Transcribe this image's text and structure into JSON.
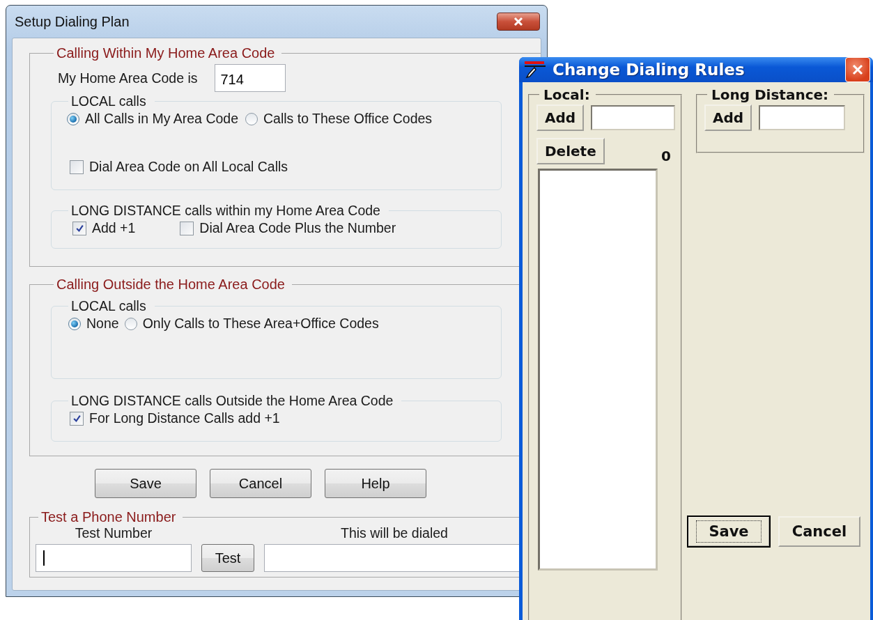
{
  "setup_window": {
    "title": "Setup Dialing Plan",
    "home_group": {
      "legend": "Calling Within My Home Area Code",
      "area_code_label": "My Home Area Code is",
      "area_code_value": "714",
      "local": {
        "legend": "LOCAL calls",
        "options": [
          {
            "label": "All Calls in My Area Code",
            "selected": true
          },
          {
            "label": "Calls to These Office Codes",
            "selected": false
          }
        ],
        "dial_area_code": {
          "label": "Dial Area Code on All Local Calls",
          "checked": false
        }
      },
      "long_distance": {
        "legend": "LONG DISTANCE calls within my Home Area Code",
        "options": [
          {
            "label": "Add +1",
            "checked": true
          },
          {
            "label": "Dial Area Code Plus the Number",
            "checked": false
          }
        ]
      }
    },
    "outside_group": {
      "legend": "Calling Outside the Home Area Code",
      "local": {
        "legend": "LOCAL calls",
        "options": [
          {
            "label": "None",
            "selected": true
          },
          {
            "label": "Only Calls to These Area+Office Codes",
            "selected": false
          }
        ]
      },
      "long_distance": {
        "legend": "LONG DISTANCE calls Outside the Home Area Code",
        "options": [
          {
            "label": "For Long Distance Calls add +1",
            "checked": true
          }
        ]
      }
    },
    "buttons": [
      "Save",
      "Cancel",
      "Help"
    ],
    "test_group": {
      "legend": "Test a Phone Number",
      "number_label": "Test Number",
      "number_focused": true,
      "test_button": "Test",
      "result_label": "This will be dialed"
    }
  },
  "rules_window": {
    "title": "Change Dialing Rules",
    "local": {
      "legend": "Local:",
      "add_button": "Add",
      "delete_button": "Delete",
      "count": "0"
    },
    "long_distance": {
      "legend": "Long Distance:",
      "add_button": "Add"
    },
    "buttons": [
      {
        "label": "Save",
        "focused": true
      },
      {
        "label": "Cancel",
        "focused": false
      }
    ]
  }
}
